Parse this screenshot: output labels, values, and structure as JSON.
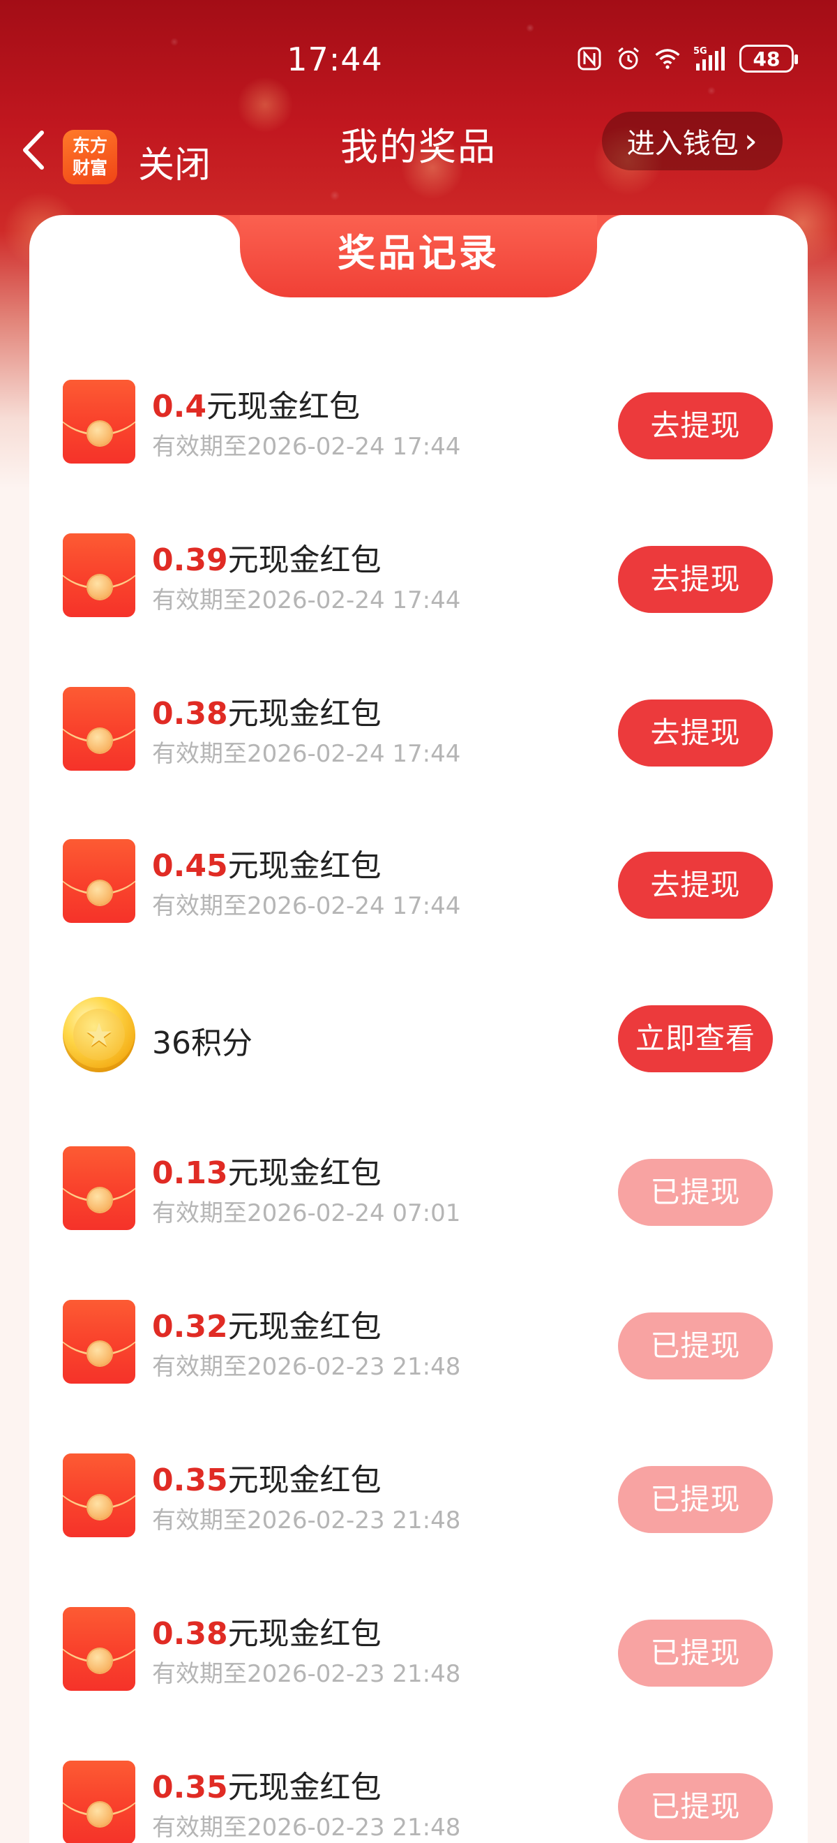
{
  "status_bar": {
    "time": "17:44",
    "battery": "48",
    "icons": [
      "nfc-icon",
      "alarm-icon",
      "wifi-icon",
      "signal-5g-icon",
      "battery-icon"
    ]
  },
  "header": {
    "back_icon": "chevron-left-icon",
    "app_logo_line1": "东方",
    "app_logo_line2": "财富",
    "close_label": "关闭",
    "title": "我的奖品",
    "wallet_label": "进入钱包",
    "wallet_chevron": "›"
  },
  "card": {
    "tab_title": "奖品记录"
  },
  "colors": {
    "accent": "#ec3a3c",
    "amount": "#e02b24",
    "done_button": "#f8a3a2",
    "subtext": "#b5b5b5"
  },
  "items": [
    {
      "type": "red-packet",
      "amount": "0.4",
      "suffix": "元现金红包",
      "expiry": "有效期至2026-02-24 17:44",
      "action": "去提现",
      "state": "active"
    },
    {
      "type": "red-packet",
      "amount": "0.39",
      "suffix": "元现金红包",
      "expiry": "有效期至2026-02-24 17:44",
      "action": "去提现",
      "state": "active"
    },
    {
      "type": "red-packet",
      "amount": "0.38",
      "suffix": "元现金红包",
      "expiry": "有效期至2026-02-24 17:44",
      "action": "去提现",
      "state": "active"
    },
    {
      "type": "red-packet",
      "amount": "0.45",
      "suffix": "元现金红包",
      "expiry": "有效期至2026-02-24 17:44",
      "action": "去提现",
      "state": "active"
    },
    {
      "type": "points",
      "label": "36积分",
      "action": "立即查看",
      "state": "active"
    },
    {
      "type": "red-packet",
      "amount": "0.13",
      "suffix": "元现金红包",
      "expiry": "有效期至2026-02-24 07:01",
      "action": "已提现",
      "state": "done"
    },
    {
      "type": "red-packet",
      "amount": "0.32",
      "suffix": "元现金红包",
      "expiry": "有效期至2026-02-23 21:48",
      "action": "已提现",
      "state": "done"
    },
    {
      "type": "red-packet",
      "amount": "0.35",
      "suffix": "元现金红包",
      "expiry": "有效期至2026-02-23 21:48",
      "action": "已提现",
      "state": "done"
    },
    {
      "type": "red-packet",
      "amount": "0.38",
      "suffix": "元现金红包",
      "expiry": "有效期至2026-02-23 21:48",
      "action": "已提现",
      "state": "done"
    },
    {
      "type": "red-packet",
      "amount": "0.35",
      "suffix": "元现金红包",
      "expiry": "有效期至2026-02-23 21:48",
      "action": "已提现",
      "state": "done"
    }
  ]
}
